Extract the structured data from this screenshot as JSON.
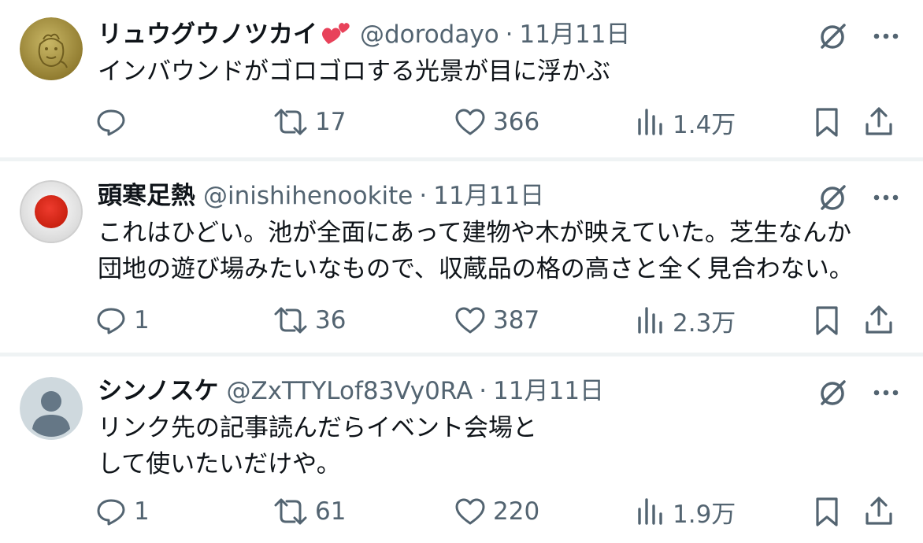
{
  "tweets": [
    {
      "name": "リュウグウノツカイ",
      "handle": "@dorodayo",
      "dot": "·",
      "date": "11月11日",
      "text": "インバウンドがゴロゴロする光景が目に浮かぶ",
      "replies": "",
      "retweets": "17",
      "likes": "366",
      "views": "1.4万",
      "avatar_icon": "gold-coin-avatar",
      "name_emoji": "two-hearts-icon"
    },
    {
      "name": "頭寒足熱",
      "handle": "@inishihenookite",
      "dot": "·",
      "date": "11月11日",
      "text": "これはひどい。池が全面にあって建物や木が映えていた。芝生なんか\n団地の遊び場みたいなもので、収蔵品の格の高さと全く見合わない。",
      "replies": "1",
      "retweets": "36",
      "likes": "387",
      "views": "2.3万",
      "avatar_icon": "red-sun-avatar"
    },
    {
      "name": "シンノスケ",
      "handle": "@ZxTTYLof83Vy0RA",
      "dot": "·",
      "date": "11月11日",
      "text": "リンク先の記事読んだらイベント会場と\nして使いたいだけや。",
      "replies": "1",
      "retweets": "61",
      "likes": "220",
      "views": "1.9万",
      "avatar_icon": "default-person-avatar"
    }
  ],
  "colors": {
    "text_primary": "#0f1419",
    "text_secondary": "#536471",
    "divider": "#eff3f4",
    "heart_emoji": "#e8425a"
  }
}
